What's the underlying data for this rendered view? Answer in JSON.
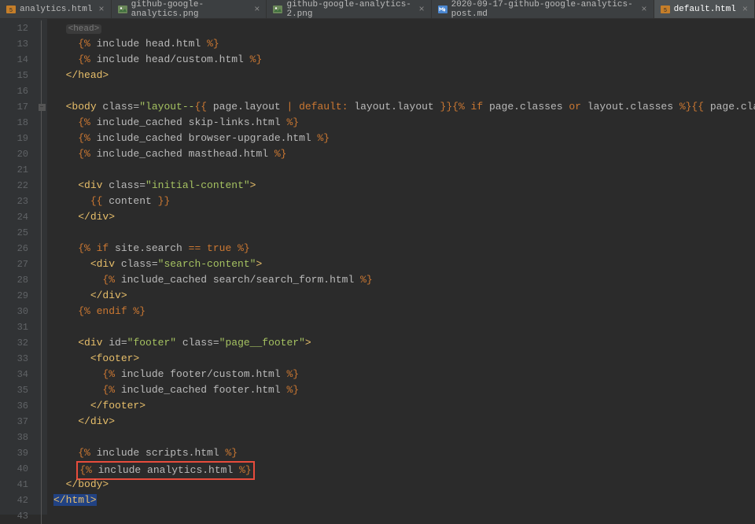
{
  "tabs": [
    {
      "label": "analytics.html",
      "icon": "html"
    },
    {
      "label": "github-google-analytics.png",
      "icon": "image"
    },
    {
      "label": "github-google-analytics-2.png",
      "icon": "image"
    },
    {
      "label": "2020-09-17-github-google-analytics-post.md",
      "icon": "md"
    },
    {
      "label": "default.html",
      "icon": "html",
      "active": true
    }
  ],
  "first_line_number": 12,
  "last_line_number": 43,
  "highlighted_line": 40,
  "code_lines": [
    {
      "n": 12,
      "indent": 1,
      "tokens": [
        [
          "truncated",
          "<head>"
        ]
      ]
    },
    {
      "n": 13,
      "indent": 2,
      "tokens": [
        [
          "liquid",
          "{% "
        ],
        [
          "attr",
          "include head.html "
        ],
        [
          "liquid",
          "%}"
        ]
      ]
    },
    {
      "n": 14,
      "indent": 2,
      "tokens": [
        [
          "liquid",
          "{% "
        ],
        [
          "attr",
          "include head/custom.html "
        ],
        [
          "liquid",
          "%}"
        ]
      ]
    },
    {
      "n": 15,
      "indent": 1,
      "tokens": [
        [
          "tag",
          "</head>"
        ]
      ]
    },
    {
      "n": 16,
      "indent": 0,
      "tokens": []
    },
    {
      "n": 17,
      "indent": 1,
      "tokens": [
        [
          "tag",
          "<body "
        ],
        [
          "attr",
          "class="
        ],
        [
          "str",
          "\"layout--"
        ],
        [
          "liquid",
          "{{ "
        ],
        [
          "attr",
          "page.layout "
        ],
        [
          "liquid",
          "| default:"
        ],
        [
          "attr",
          " layout.layout "
        ],
        [
          "liquid",
          "}}"
        ],
        [
          "liquid",
          "{% if "
        ],
        [
          "attr",
          "page.classes "
        ],
        [
          "liquid",
          "or "
        ],
        [
          "attr",
          "layout.classes "
        ],
        [
          "liquid",
          "%}{{ "
        ],
        [
          "attr",
          "page.class"
        ]
      ]
    },
    {
      "n": 18,
      "indent": 2,
      "tokens": [
        [
          "liquid",
          "{% "
        ],
        [
          "attr",
          "include_cached skip-links.html "
        ],
        [
          "liquid",
          "%}"
        ]
      ]
    },
    {
      "n": 19,
      "indent": 2,
      "tokens": [
        [
          "liquid",
          "{% "
        ],
        [
          "attr",
          "include_cached browser-upgrade.html "
        ],
        [
          "liquid",
          "%}"
        ]
      ]
    },
    {
      "n": 20,
      "indent": 2,
      "tokens": [
        [
          "liquid",
          "{% "
        ],
        [
          "attr",
          "include_cached masthead.html "
        ],
        [
          "liquid",
          "%}"
        ]
      ]
    },
    {
      "n": 21,
      "indent": 0,
      "tokens": []
    },
    {
      "n": 22,
      "indent": 2,
      "tokens": [
        [
          "tag",
          "<div "
        ],
        [
          "attr",
          "class="
        ],
        [
          "str",
          "\"initial-content\""
        ],
        [
          "tag",
          ">"
        ]
      ]
    },
    {
      "n": 23,
      "indent": 3,
      "tokens": [
        [
          "liquid",
          "{{ "
        ],
        [
          "attr",
          "content "
        ],
        [
          "liquid",
          "}}"
        ]
      ]
    },
    {
      "n": 24,
      "indent": 2,
      "tokens": [
        [
          "tag",
          "</div>"
        ]
      ]
    },
    {
      "n": 25,
      "indent": 0,
      "tokens": []
    },
    {
      "n": 26,
      "indent": 2,
      "tokens": [
        [
          "liquid",
          "{% if "
        ],
        [
          "attr",
          "site.search "
        ],
        [
          "liquid",
          "== true %}"
        ]
      ]
    },
    {
      "n": 27,
      "indent": 3,
      "tokens": [
        [
          "tag",
          "<div "
        ],
        [
          "attr",
          "class="
        ],
        [
          "str",
          "\"search-content\""
        ],
        [
          "tag",
          ">"
        ]
      ]
    },
    {
      "n": 28,
      "indent": 4,
      "tokens": [
        [
          "liquid",
          "{% "
        ],
        [
          "attr",
          "include_cached search/search_form.html "
        ],
        [
          "liquid",
          "%}"
        ]
      ]
    },
    {
      "n": 29,
      "indent": 3,
      "tokens": [
        [
          "tag",
          "</div>"
        ]
      ]
    },
    {
      "n": 30,
      "indent": 2,
      "tokens": [
        [
          "liquid",
          "{% endif %}"
        ]
      ]
    },
    {
      "n": 31,
      "indent": 0,
      "tokens": []
    },
    {
      "n": 32,
      "indent": 2,
      "tokens": [
        [
          "tag",
          "<div "
        ],
        [
          "attr",
          "id="
        ],
        [
          "str",
          "\"footer\""
        ],
        [
          "attr",
          " class="
        ],
        [
          "str",
          "\"page__footer\""
        ],
        [
          "tag",
          ">"
        ]
      ]
    },
    {
      "n": 33,
      "indent": 3,
      "tokens": [
        [
          "tag",
          "<footer>"
        ]
      ]
    },
    {
      "n": 34,
      "indent": 4,
      "tokens": [
        [
          "liquid",
          "{% "
        ],
        [
          "attr",
          "include footer/custom.html "
        ],
        [
          "liquid",
          "%}"
        ]
      ]
    },
    {
      "n": 35,
      "indent": 4,
      "tokens": [
        [
          "liquid",
          "{% "
        ],
        [
          "attr",
          "include_cached footer.html "
        ],
        [
          "liquid",
          "%}"
        ]
      ]
    },
    {
      "n": 36,
      "indent": 3,
      "tokens": [
        [
          "tag",
          "</footer>"
        ]
      ]
    },
    {
      "n": 37,
      "indent": 2,
      "tokens": [
        [
          "tag",
          "</div>"
        ]
      ]
    },
    {
      "n": 38,
      "indent": 0,
      "tokens": []
    },
    {
      "n": 39,
      "indent": 2,
      "tokens": [
        [
          "liquid",
          "{% "
        ],
        [
          "attr",
          "include scripts.html "
        ],
        [
          "liquid",
          "%}"
        ]
      ]
    },
    {
      "n": 40,
      "indent": 2,
      "highlight": "red",
      "tokens": [
        [
          "liquid",
          "{% "
        ],
        [
          "attr",
          "include analytics.html "
        ],
        [
          "liquid",
          "%}"
        ]
      ]
    },
    {
      "n": 41,
      "indent": 1,
      "tokens": [
        [
          "tag",
          "</body>"
        ]
      ]
    },
    {
      "n": 42,
      "indent": 0,
      "highlight": "sel",
      "tokens": [
        [
          "tag",
          "</html>"
        ]
      ]
    },
    {
      "n": 43,
      "indent": 0,
      "tokens": []
    }
  ],
  "fold_markers": {
    "17": "minus"
  }
}
